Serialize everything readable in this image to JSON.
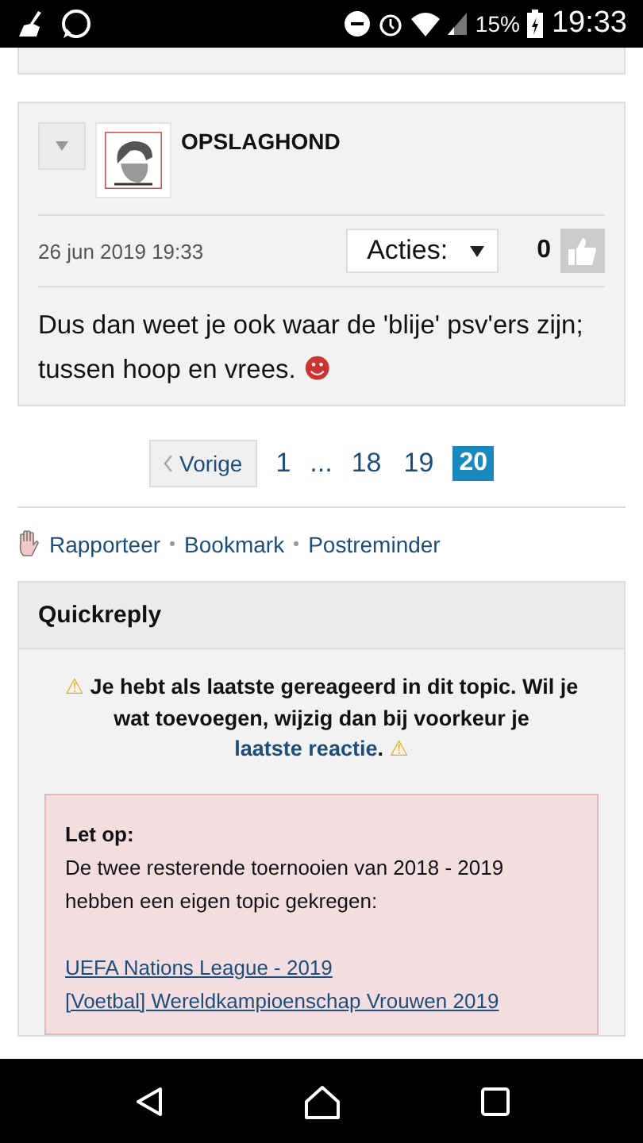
{
  "status_bar": {
    "battery": "15%",
    "time": "19:33"
  },
  "post": {
    "author": "OPSLAGHOND",
    "date": "26 jun 2019 19:33",
    "actions_label": "Acties:",
    "likes": "0",
    "body": [
      {
        "kind": "text",
        "text": "Dus dan weet je ook waar de 'blije' psv'ers zijn; tussen hoop en vrees. "
      },
      {
        "kind": "emoticon",
        "text": "☻"
      }
    ]
  },
  "pagination": {
    "previous": "Vorige",
    "items": [
      {
        "kind": "page",
        "label": "1",
        "selected": false
      },
      {
        "kind": "ellipsis",
        "label": "..."
      },
      {
        "kind": "page",
        "label": "18",
        "selected": false
      },
      {
        "kind": "page",
        "label": "19",
        "selected": false
      },
      {
        "kind": "page",
        "label": "20",
        "selected": true
      }
    ]
  },
  "topic_links": [
    "Rapporteer",
    "Bookmark",
    "Postreminder"
  ],
  "quickreply": {
    "title": "Quickreply",
    "notice": [
      {
        "kind": "warning",
        "text": "⚠"
      },
      {
        "kind": "text",
        "text": " Je hebt als laatste gereageerd in dit topic. Wil je wat toevoegen, wijzig dan bij voorkeur je "
      },
      {
        "kind": "link",
        "text": "laatste reactie"
      },
      {
        "kind": "text",
        "text": ". "
      },
      {
        "kind": "warning",
        "text": "⚠"
      }
    ],
    "alert": {
      "title": "Let op:",
      "text": "De twee resterende toernooien van 2018 - 2019 hebben een eigen topic gekregen:",
      "links": [
        "UEFA Nations League - 2019",
        "[Voetbal] Wereldkampioenschap Vrouwen 2019"
      ]
    }
  }
}
